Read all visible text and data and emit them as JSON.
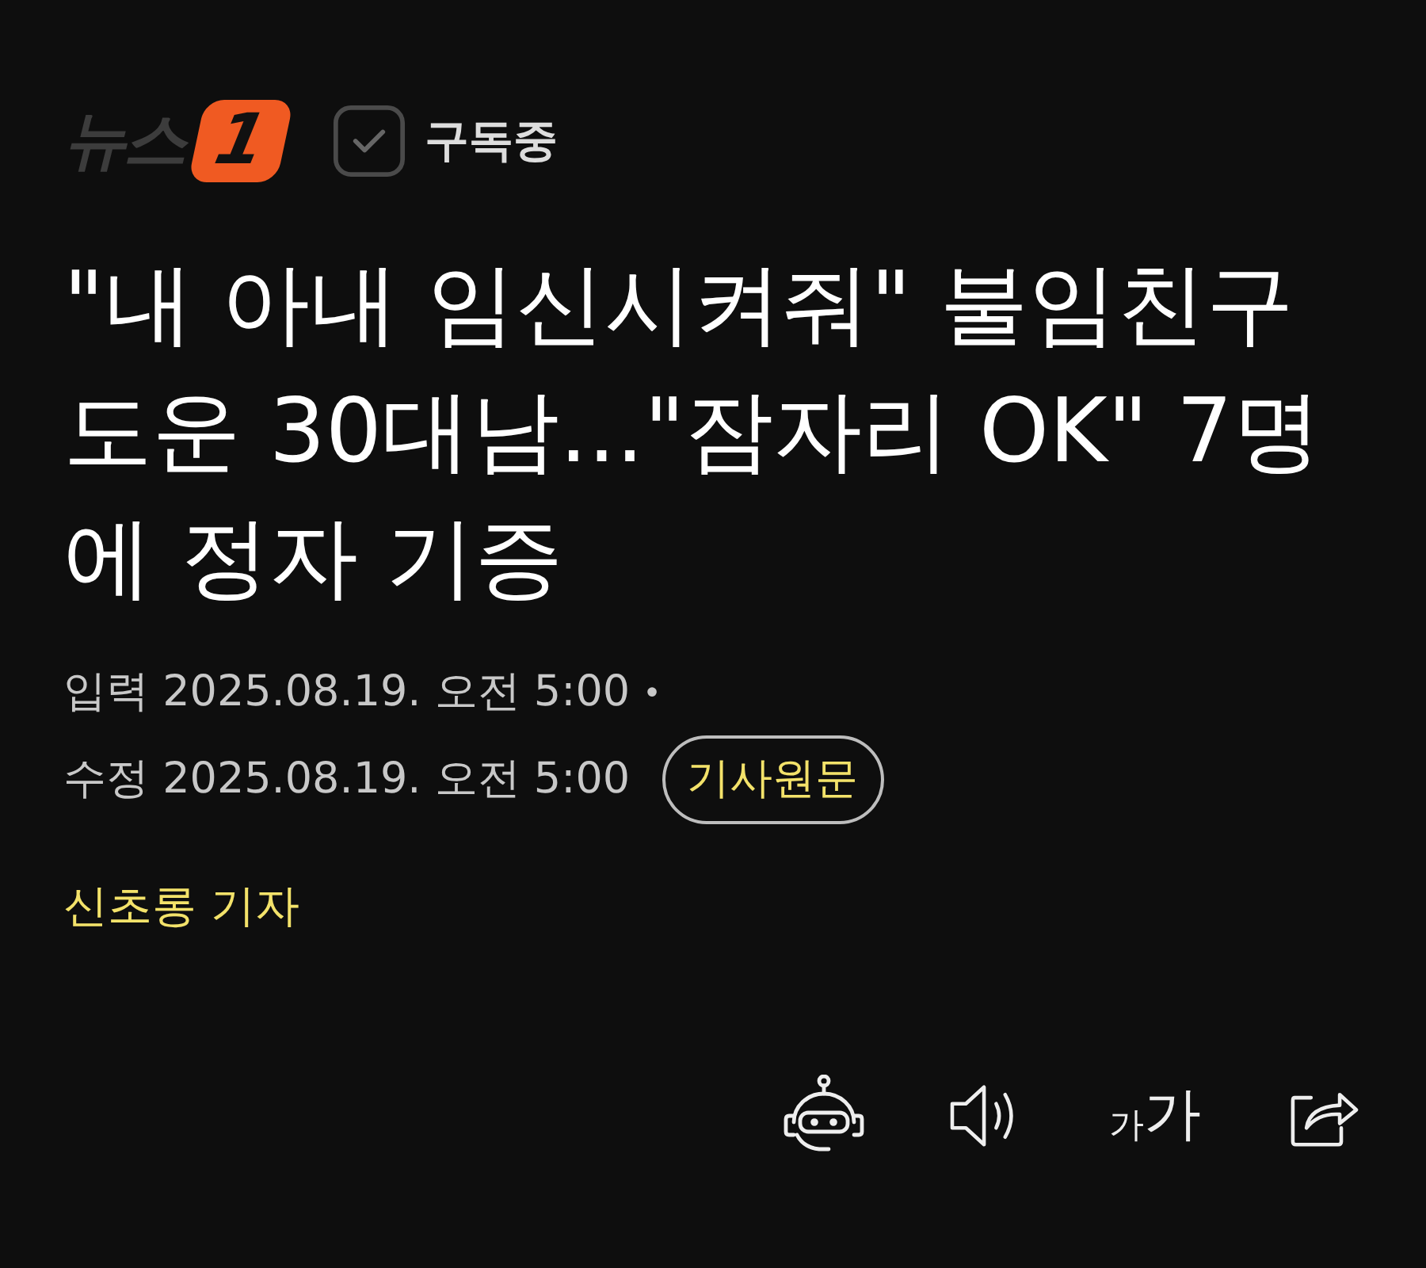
{
  "header": {
    "logo": {
      "text": "뉴스",
      "badge": "1"
    },
    "subscribe": {
      "label": "구독중",
      "checked": true
    }
  },
  "article": {
    "title": "\"내 아내 임신시켜줘\" 불임친구 도운 30대남...\"잠자리 OK\" 7명에 정자 기증",
    "meta": {
      "published": "입력 2025.08.19. 오전 5:00",
      "separator": "•",
      "modified": "수정 2025.08.19. 오전 5:00",
      "source_button": "기사원문"
    },
    "reporter": "신초롱 기자"
  },
  "toolbar": [
    {
      "kind": "robot"
    },
    {
      "kind": "speaker"
    },
    {
      "kind": "font_size",
      "small": "가",
      "large": "가"
    },
    {
      "kind": "share"
    }
  ]
}
